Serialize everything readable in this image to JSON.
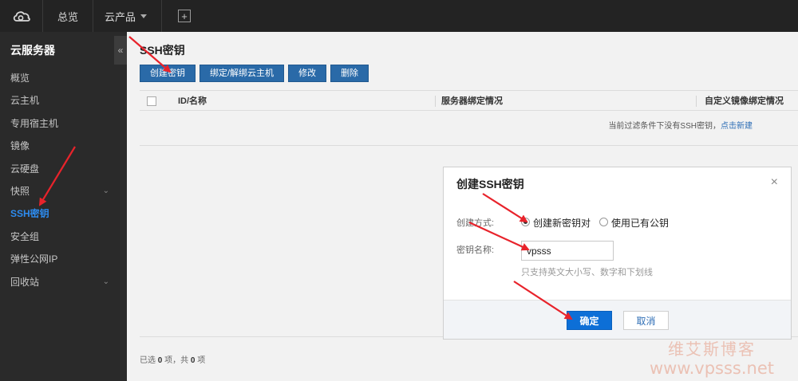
{
  "topbar": {
    "nav_overview": "总览",
    "nav_products": "云产品"
  },
  "sidebar": {
    "title": "云服务器",
    "collapse_glyph": "«",
    "items": [
      {
        "label": "概览",
        "expandable": false,
        "active": false
      },
      {
        "label": "云主机",
        "expandable": false,
        "active": false
      },
      {
        "label": "专用宿主机",
        "expandable": false,
        "active": false
      },
      {
        "label": "镜像",
        "expandable": false,
        "active": false
      },
      {
        "label": "云硬盘",
        "expandable": false,
        "active": false
      },
      {
        "label": "快照",
        "expandable": true,
        "active": false
      },
      {
        "label": "SSH密钥",
        "expandable": false,
        "active": true
      },
      {
        "label": "安全组",
        "expandable": false,
        "active": false
      },
      {
        "label": "弹性公网IP",
        "expandable": false,
        "active": false
      },
      {
        "label": "回收站",
        "expandable": true,
        "active": false
      }
    ]
  },
  "main": {
    "title": "SSH密钥",
    "toolbar": {
      "create": "创建密钥",
      "bind": "绑定/解绑云主机",
      "edit": "修改",
      "delete": "删除"
    },
    "table": {
      "col_id": "ID/名称",
      "col_binding": "服务器绑定情况",
      "col_image": "自定义镜像绑定情况",
      "empty_text": "当前过滤条件下没有SSH密钥，",
      "empty_link": "点击新建"
    },
    "footer": {
      "selected_prefix": "已选",
      "selected_count": "0",
      "selected_suffix": "项，共",
      "total_count": "0",
      "total_suffix": "项"
    }
  },
  "modal": {
    "title": "创建SSH密钥",
    "close_glyph": "×",
    "method_label": "创建方式:",
    "option_new": "创建新密钥对",
    "option_existing": "使用已有公钥",
    "name_label": "密钥名称:",
    "name_value": "vpsss",
    "hint": "只支持英文大小写、数字和下划线",
    "ok": "确定",
    "cancel": "取消"
  },
  "watermark": {
    "line1": "维艾斯博客",
    "line2": "www.vpsss.net"
  },
  "colors": {
    "topbar": "#232323",
    "sidebar": "#2a2a2a",
    "active_item": "#2d8cf0",
    "toolbar_button": "#2a6aa8",
    "primary_button": "#0d6fd7",
    "annotation_arrow": "#e8232b"
  }
}
